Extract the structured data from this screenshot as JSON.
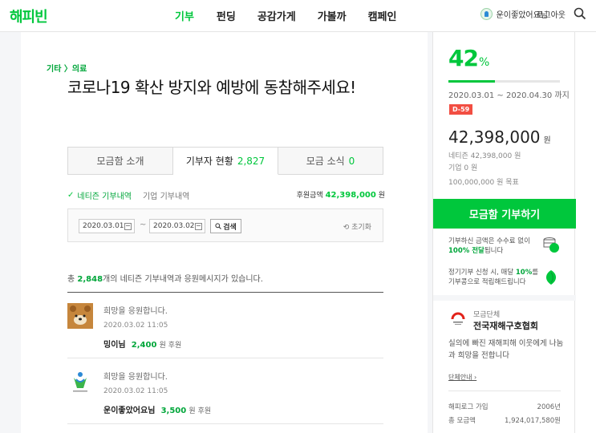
{
  "header": {
    "logo": "해피빈",
    "nav": [
      "기부",
      "펀딩",
      "공감가게",
      "가볼까",
      "캠페인"
    ],
    "user_name": "운이좋았어요님",
    "logout_label": "로그아웃"
  },
  "campaign": {
    "category": "기타 〉의료",
    "title": "코로나19 확산 방지와 예방에 동참해주세요!"
  },
  "tabs": [
    {
      "label": "모금함 소개",
      "count": ""
    },
    {
      "label": "기부자 현황",
      "count": "2,827"
    },
    {
      "label": "모금 소식",
      "count": "0"
    }
  ],
  "donors": {
    "subtab_citizen": "네티즌 기부내역",
    "subtab_company": "기업 기부내역",
    "sum_label": "후원금액",
    "sum_value": "42,398,000",
    "sum_unit": "원",
    "filter": {
      "date_from": "2020.03.01",
      "tilde": "~",
      "date_to": "2020.03.02",
      "search_label": "검색",
      "reset_label": "초기화"
    },
    "total_prefix": "총 ",
    "total_count": "2,848",
    "total_suffix": "개의 네티즌 기부내역과 응원메시지가 있습니다.",
    "entries": [
      {
        "message": "희망을 응원합니다.",
        "time": "2020.03.02 11:05",
        "name": "밍이님",
        "amount": "2,400",
        "unit": "원 후원",
        "avatar_icon": "bear-avatar-icon"
      },
      {
        "message": "희망을 응원합니다.",
        "time": "2020.03.02 11:05",
        "name": "운이좋았어요님",
        "amount": "3,500",
        "unit": "원 후원",
        "avatar_icon": "person-logo-avatar-icon"
      }
    ]
  },
  "sidebar": {
    "percent": "42",
    "percent_unit": "%",
    "progress": 0.42,
    "period": "2020.03.01 ~ 2020.04.30 까지",
    "dday": "D-59",
    "raised": "42,398,000",
    "raised_unit": "원",
    "netizen": "네티즌 42,398,000 원",
    "company": "기업 0 원",
    "goal": "100,000,000 원 목표",
    "donate_label": "모금함 기부하기",
    "info1_a": "기부하신 금액은 수수료 없이 ",
    "info1_b": "100% 전달",
    "info1_c": "됩니다",
    "info2_a": "정기기부 신청 시, 매달 ",
    "info2_b": "10%",
    "info2_c": "를 기부콩으로 적립해드립니다",
    "org_type": "모금단체",
    "org_name": "전국재해구호협회",
    "org_desc": "실의에 빠진 재해피해 이웃에게 나눔과 희망을 전합니다",
    "org_more": "단체안내 ›",
    "stats": [
      {
        "label": "해피로그 가입",
        "value": "2006년"
      },
      {
        "label": "총 모금액",
        "value": "1,924,017,580원"
      }
    ]
  },
  "colors": {
    "brand": "#00c73c",
    "dday": "#f24e42"
  }
}
